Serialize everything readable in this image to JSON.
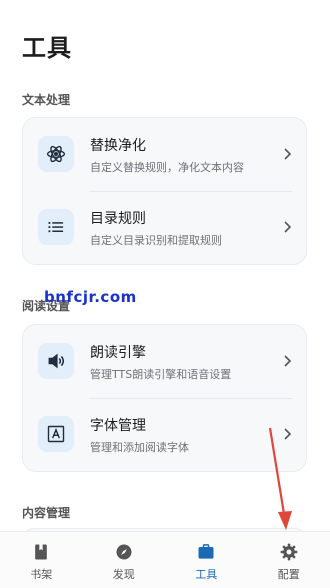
{
  "page": {
    "title": "工具"
  },
  "sections": [
    {
      "label": "文本处理",
      "items": [
        {
          "title": "替换净化",
          "subtitle": "自定义替换规则，净化文本内容",
          "icon": "atom-icon"
        },
        {
          "title": "目录规则",
          "subtitle": "自定义目录识别和提取规则",
          "icon": "list-icon"
        }
      ]
    },
    {
      "label": "阅读设置",
      "items": [
        {
          "title": "朗读引擎",
          "subtitle": "管理TTS朗读引擎和语音设置",
          "icon": "speaker-icon"
        },
        {
          "title": "字体管理",
          "subtitle": "管理和添加阅读字体",
          "icon": "font-icon"
        }
      ]
    },
    {
      "label": "内容管理",
      "items": []
    }
  ],
  "watermark": "bnfcjr.com",
  "nav": [
    {
      "label": "书架",
      "icon": "bookshelf-icon",
      "active": false
    },
    {
      "label": "发现",
      "icon": "compass-icon",
      "active": false
    },
    {
      "label": "工具",
      "icon": "toolbox-icon",
      "active": true
    },
    {
      "label": "配置",
      "icon": "gear-icon",
      "active": false
    }
  ],
  "colors": {
    "accent": "#1c6ab5",
    "icon_bg": "#e3eefb",
    "annotation_arrow": "#e0463a"
  }
}
